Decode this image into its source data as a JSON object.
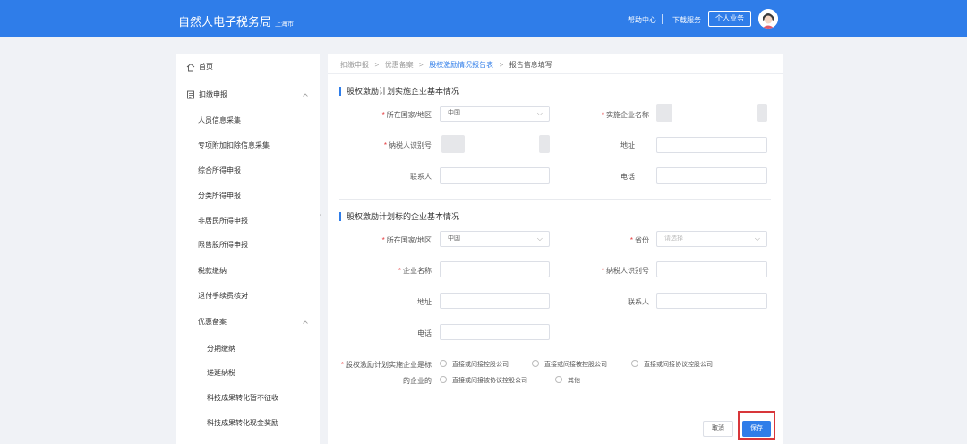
{
  "header": {
    "title": "自然人电子税务局",
    "region": "上海市",
    "links": [
      "帮助中心",
      "下载服务"
    ],
    "business_button": "个人业务"
  },
  "sidebar": {
    "items": [
      {
        "label": "首页",
        "icon": "home-icon"
      },
      {
        "label": "扣缴申报",
        "icon": "document-icon",
        "expanded": true
      },
      {
        "label": "人员信息采集"
      },
      {
        "label": "专项附加扣除信息采集"
      },
      {
        "label": "综合所得申报"
      },
      {
        "label": "分类所得申报"
      },
      {
        "label": "非居民所得申报"
      },
      {
        "label": "限售股所得申报"
      },
      {
        "label": "税款缴纳"
      },
      {
        "label": "退付手续费核对"
      },
      {
        "label": "优惠备案",
        "expanded": true
      },
      {
        "label": "分期缴纳"
      },
      {
        "label": "递延纳税"
      },
      {
        "label": "科技成果转化暂不征收"
      },
      {
        "label": "科技成果转化现金奖励"
      }
    ]
  },
  "breadcrumb": [
    "扣缴申报",
    "优惠备案",
    "股权激励情况报告表",
    "报告信息填写"
  ],
  "section1": {
    "title": "股权激励计划实施企业基本情况",
    "country_label": "所在国家/地区",
    "country_value": "中国",
    "company_name_label": "实施企业名称",
    "tax_id_label": "纳税人识别号",
    "address_label": "地址",
    "contact_label": "联系人",
    "phone_label": "电话"
  },
  "section2": {
    "title": "股权激励计划标的企业基本情况",
    "country_label": "所在国家/地区",
    "country_value": "中国",
    "province_label": "省份",
    "province_placeholder": "请选择",
    "company_name_label": "企业名称",
    "tax_id_label": "纳税人识别号",
    "address_label": "地址",
    "contact_label": "联系人",
    "phone_label": "电话",
    "relation_label_line1": "股权激励计划实施企业是标",
    "relation_label_line2": "的企业的",
    "relation_options": [
      "直接或间接控股公司",
      "直接或间接被控股公司",
      "直接或间接协议控股公司",
      "直接或间接被协议控股公司",
      "其他"
    ]
  },
  "footer": {
    "cancel_label": "取消",
    "save_label": "保存"
  },
  "colors": {
    "primary": "#2f7de9",
    "required": "#e4393c",
    "highlight": "#d8363a"
  }
}
